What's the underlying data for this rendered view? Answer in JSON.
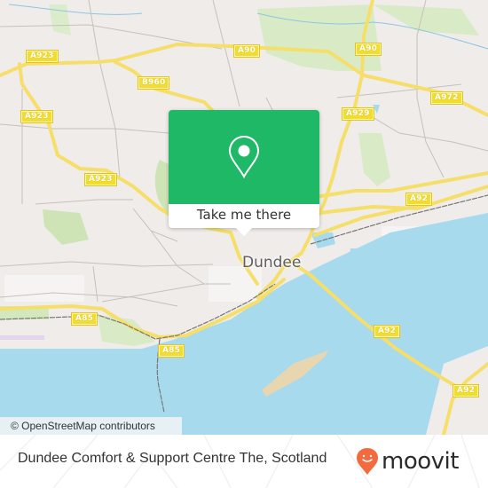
{
  "map": {
    "city_label": "Dundee",
    "road_labels": [
      {
        "id": "a923-1",
        "text": "A923"
      },
      {
        "id": "a923-2",
        "text": "A923"
      },
      {
        "id": "a923-3",
        "text": "A923"
      },
      {
        "id": "b960",
        "text": "B960"
      },
      {
        "id": "a90-1",
        "text": "A90"
      },
      {
        "id": "a90-2",
        "text": "A90"
      },
      {
        "id": "a972",
        "text": "A972"
      },
      {
        "id": "a929",
        "text": "A929"
      },
      {
        "id": "a92-1",
        "text": "A92"
      },
      {
        "id": "a92-2",
        "text": "A92"
      },
      {
        "id": "a92-3",
        "text": "A92"
      },
      {
        "id": "a85-1",
        "text": "A85"
      },
      {
        "id": "a85-2",
        "text": "A85"
      }
    ],
    "attribution": "© OpenStreetMap contributors",
    "colors": {
      "land": "#f0ecea",
      "water": "#a8daed",
      "park": "#d3e8bd",
      "sand": "#e8d6b0",
      "road_major": "#f7e47a",
      "road_minor": "#bdb6b2",
      "railway": "#7a7a7a"
    }
  },
  "popup": {
    "pin_icon": "map-pin-icon",
    "button_label": "Take me there",
    "accent_color": "#1fb866"
  },
  "footer": {
    "place_title": "Dundee Comfort & Support Centre The, Scotland",
    "brand_name": "moovit",
    "brand_color": "#f26a3d"
  }
}
